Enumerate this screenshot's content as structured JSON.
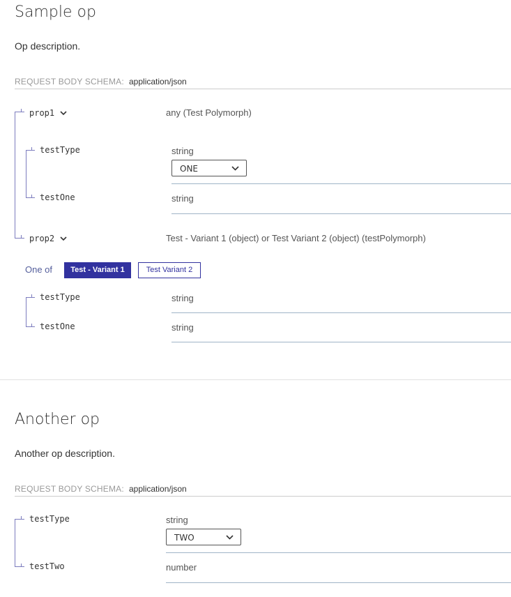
{
  "ops": [
    {
      "title": "Sample op",
      "description": "Op description.",
      "schema_label": "REQUEST BODY SCHEMA:",
      "schema_type": "application/json",
      "props": {
        "prop1": {
          "name": "prop1",
          "type": "any (Test Polymorph)",
          "expanded": true
        },
        "prop1_children": [
          {
            "name": "testType",
            "type": "string",
            "enum_selected": "ONE"
          },
          {
            "name": "testOne",
            "type": "string"
          }
        ],
        "prop2": {
          "name": "prop2",
          "type": "Test - Variant 1 (object) or Test Variant 2 (object) (testPolymorph)",
          "expanded": true
        },
        "oneof": {
          "label": "One of",
          "options": [
            "Test - Variant 1",
            "Test Variant 2"
          ],
          "selected": "Test - Variant 1"
        },
        "prop2_children": [
          {
            "name": "testType",
            "type": "string"
          },
          {
            "name": "testOne",
            "type": "string"
          }
        ]
      }
    },
    {
      "title": "Another op",
      "description": "Another op description.",
      "schema_label": "REQUEST BODY SCHEMA:",
      "schema_type": "application/json",
      "props": [
        {
          "name": "testType",
          "type": "string",
          "enum_selected": "TWO"
        },
        {
          "name": "testTwo",
          "type": "number"
        }
      ]
    }
  ],
  "colors": {
    "accent": "#32329f",
    "tree_line": "#7c7cbe",
    "divider": "#9fb4c7",
    "muted": "#999999"
  },
  "icons": [
    "chevron-down-icon"
  ]
}
